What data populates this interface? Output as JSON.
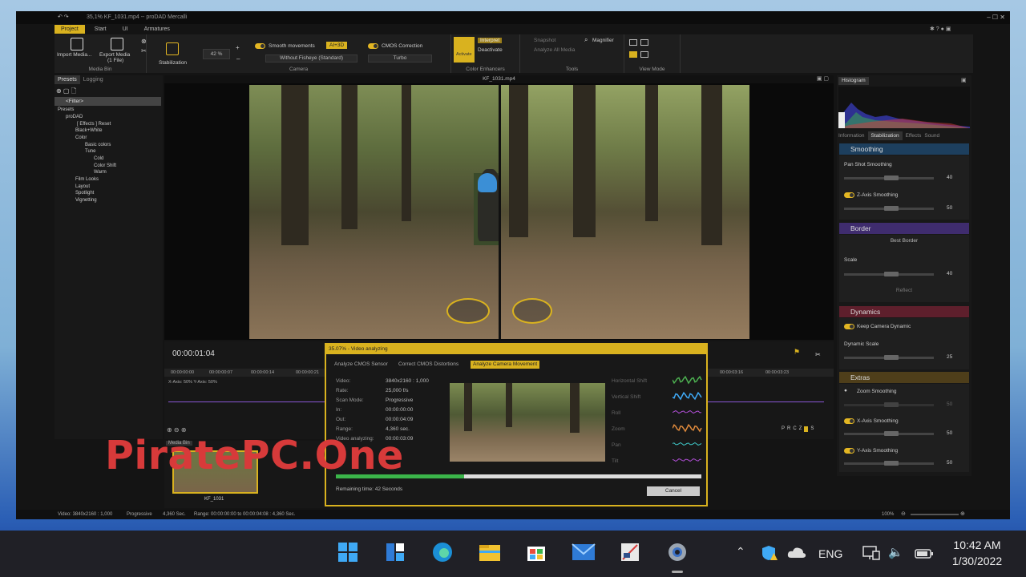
{
  "window": {
    "title": "35,1% KF_1031.mp4 -- proDAD Mercalli"
  },
  "ribbon": {
    "tabs": [
      "Project",
      "Start",
      "UI",
      "Armatures"
    ],
    "import_label": "Import Media...",
    "export_label": "Export Media",
    "export_sub": "(1 File)",
    "media_bin_group": "Media Bin",
    "stabilization_label": "Stabilization",
    "zoom_value": "42 %",
    "smooth_movements": "Smooth movements",
    "ai_badge": "AI+3D",
    "fisheye_value": "Without Fisheye (Standard)",
    "cmos_correction": "CMOS Correction",
    "cmos_value": "Turbo",
    "camera_group": "Camera",
    "activate": "Activate",
    "interpret": "Interpret",
    "deactivate": "Deactivate",
    "color_group": "Color Enhancers",
    "snapshot": "Snapshot",
    "magnifier": "Magnifier",
    "analyze_all": "Analyze All Media",
    "tools_group": "Tools",
    "view_mode_group": "View Mode"
  },
  "left_panel": {
    "tabs": [
      "Presets",
      "Logging"
    ],
    "filter_placeholder": "<Filter>",
    "tree": [
      "Presets",
      "proDAD",
      "[ Effects ] Reset",
      "Black+White",
      "Color",
      "Basic colors",
      "Tune",
      "Cold",
      "Color Shift",
      "Warm",
      "Film Looks",
      "Layout",
      "Spotlight",
      "Vignetting"
    ]
  },
  "viewer": {
    "file_title": "KF_1031.mp4"
  },
  "timeline": {
    "timecode": "00:00:01:04",
    "axes_text": "X-Axis: 50%  Y-Axis: 50%",
    "ticks": [
      "00:00:00:00",
      "00:00:00:07",
      "00:00:00:14",
      "00:00:00:21",
      "00:00:03:16",
      "00:00:03:23"
    ],
    "letters": [
      "P",
      "R",
      "C",
      "Z",
      "",
      "S"
    ],
    "media_bin_label": "Media Bin",
    "clip_label": "KF_1031"
  },
  "dialog": {
    "title": "35.07% - Video analyzing",
    "tabs": [
      "Analyze CMOS Sensor",
      "Correct CMOS Distortions",
      "Analyze Camera Movement"
    ],
    "info": [
      {
        "k": "Video:",
        "v": "3840x2160 : 1,000"
      },
      {
        "k": "Rate:",
        "v": "25,000 f/s"
      },
      {
        "k": "Scan Mode:",
        "v": "Progressive"
      },
      {
        "k": "In:",
        "v": "00:00:00:00"
      },
      {
        "k": "Out:",
        "v": "00:00:04:09"
      },
      {
        "k": "Range:",
        "v": "4,360 sec."
      },
      {
        "k": "Video analyzing:",
        "v": "00:00:03:09"
      }
    ],
    "graphs": [
      "Horizontal Shift",
      "Vertical Shift",
      "Roll",
      "Zoom",
      "Pan",
      "Tilt"
    ],
    "graph_colors": [
      "#4caf50",
      "#3fa9f5",
      "#b04fd6",
      "#e08a3c",
      "#3fc9c9",
      "#b04fd6"
    ],
    "progress": 0.35,
    "remaining": "Remaining time: 42 Seconds",
    "cancel": "Cancel"
  },
  "right_panel": {
    "histogram_label": "Histogram",
    "tabs": [
      "Information",
      "Stabilization",
      "Effects",
      "Sound"
    ],
    "smoothing": "Smoothing",
    "pan_shot": "Pan Shot Smoothing",
    "pan_value": "40",
    "z_axis": "Z-Axis Smoothing",
    "z_value": "50",
    "border": "Border",
    "best_border": "Best Border",
    "scale": "Scale",
    "scale_value": "40",
    "reflect": "Reflect",
    "dynamics": "Dynamics",
    "keep_dynamic": "Keep Camera Dynamic",
    "dynamic_scale": "Dynamic Scale",
    "dynamic_value": "25",
    "extras": "Extras",
    "zoom_smoothing": "Zoom Smoothing",
    "zoom_value": "50",
    "x_axis": "X-Axis Smoothing",
    "x_value": "50",
    "y_axis": "Y-Axis Smoothing",
    "y_value": "50"
  },
  "status": {
    "video": "Video: 3840x2160 : 1,000",
    "scan": "Progressive",
    "length": "4,360 Sec.",
    "range": "Range: 00:00:00:00 to 00:00:04:08 : 4,360 Sec.",
    "zoom": "100%"
  },
  "watermark": "PiratePC.One",
  "taskbar": {
    "lang": "ENG",
    "time": "10:42 AM",
    "date": "1/30/2022"
  }
}
